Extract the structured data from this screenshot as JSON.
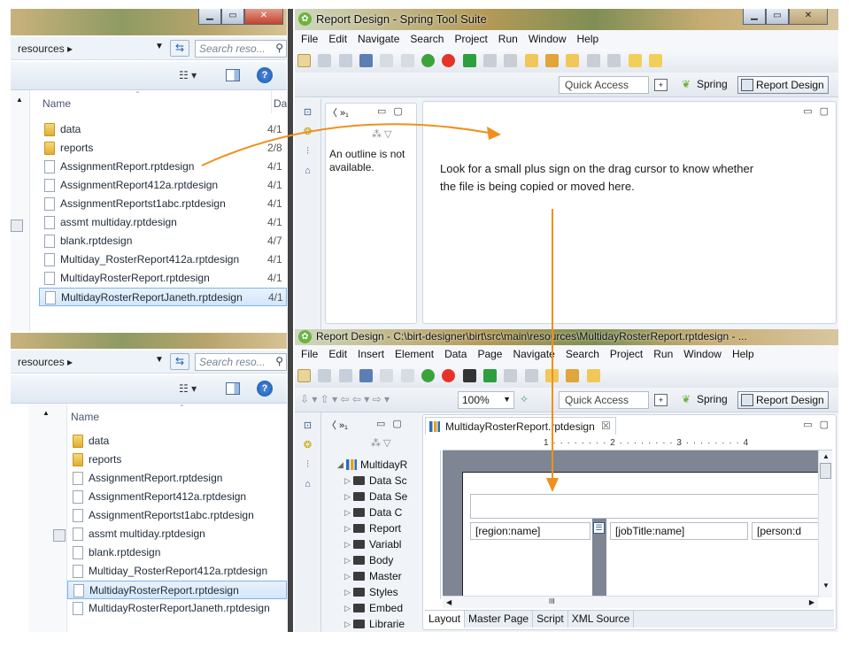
{
  "explorer": {
    "breadcrumb": "resources ▸",
    "search_placeholder": "Search reso...",
    "column_name": "Name",
    "column_date": "Da",
    "files": [
      {
        "name": "data",
        "kind": "folder",
        "date": "4/1"
      },
      {
        "name": "reports",
        "kind": "folder",
        "date": "2/8"
      },
      {
        "name": "AssignmentReport.rptdesign",
        "kind": "doc",
        "date": "4/1"
      },
      {
        "name": "AssignmentReport412a.rptdesign",
        "kind": "doc",
        "date": "4/1"
      },
      {
        "name": "AssignmentReportst1abc.rptdesign",
        "kind": "doc",
        "date": "4/1"
      },
      {
        "name": "assmt multiday.rptdesign",
        "kind": "doc",
        "date": "4/1"
      },
      {
        "name": "blank.rptdesign",
        "kind": "doc",
        "date": "4/7"
      },
      {
        "name": "Multiday_RosterReport412a.rptdesign",
        "kind": "doc",
        "date": "4/1"
      },
      {
        "name": "MultidayRosterReport.rptdesign",
        "kind": "doc",
        "date": "4/1"
      },
      {
        "name": "MultidayRosterReportJaneth.rptdesign",
        "kind": "doc",
        "date": "4/1"
      }
    ],
    "files_after": [
      {
        "name": "data",
        "kind": "folder"
      },
      {
        "name": "reports",
        "kind": "folder"
      },
      {
        "name": "AssignmentReport.rptdesign",
        "kind": "doc"
      },
      {
        "name": "AssignmentReport412a.rptdesign",
        "kind": "doc"
      },
      {
        "name": "AssignmentReportst1abc.rptdesign",
        "kind": "doc"
      },
      {
        "name": "assmt multiday.rptdesign",
        "kind": "doc"
      },
      {
        "name": "blank.rptdesign",
        "kind": "doc"
      },
      {
        "name": "Multiday_RosterReport412a.rptdesign",
        "kind": "doc"
      },
      {
        "name": "MultidayRosterReport.rptdesign",
        "kind": "doc"
      },
      {
        "name": "MultidayRosterReportJaneth.rptdesign",
        "kind": "doc"
      }
    ]
  },
  "sts_top": {
    "title": "Report Design - Spring Tool Suite",
    "menus": [
      "File",
      "Edit",
      "Navigate",
      "Search",
      "Project",
      "Run",
      "Window",
      "Help"
    ],
    "quick_access": "Quick Access",
    "persp_spring": "Spring",
    "persp_report": "Report Design",
    "outline_message": "An outline is not available.",
    "callout": "Look for a small plus sign on the drag cursor to know whether the file is being copied or moved here."
  },
  "sts_bottom": {
    "title": "Report Design - C:\\birt-designer\\birt\\src\\main\\resources\\MultidayRosterReport.rptdesign - ...",
    "menus": [
      "File",
      "Edit",
      "Insert",
      "Element",
      "Data",
      "Page",
      "Navigate",
      "Search",
      "Project",
      "Run",
      "Window",
      "Help"
    ],
    "zoom": "100%",
    "quick_access": "Quick Access",
    "persp_spring": "Spring",
    "persp_report": "Report Design",
    "editor_tab": "MultidayRosterReport.rptdesign",
    "tree_root": "MultidayR",
    "tree_items": [
      "Data Sc",
      "Data Se",
      "Data C",
      "Report",
      "Variabl",
      "Body",
      "Master",
      "Styles",
      "Embed",
      "Librarie"
    ],
    "ruler": "1 · · · · · · · · 2 · · · · · · · · 3 · · · · · · · · 4",
    "cells": [
      "[region:name]",
      "[jobTitle:name]",
      "[person:d"
    ],
    "bottom_tabs": [
      "Layout",
      "Master Page",
      "Script",
      "XML Source"
    ],
    "scroll_glyph": "III"
  },
  "colors": {
    "arrow": "#f0901c",
    "selection": "#d2e6fa"
  }
}
